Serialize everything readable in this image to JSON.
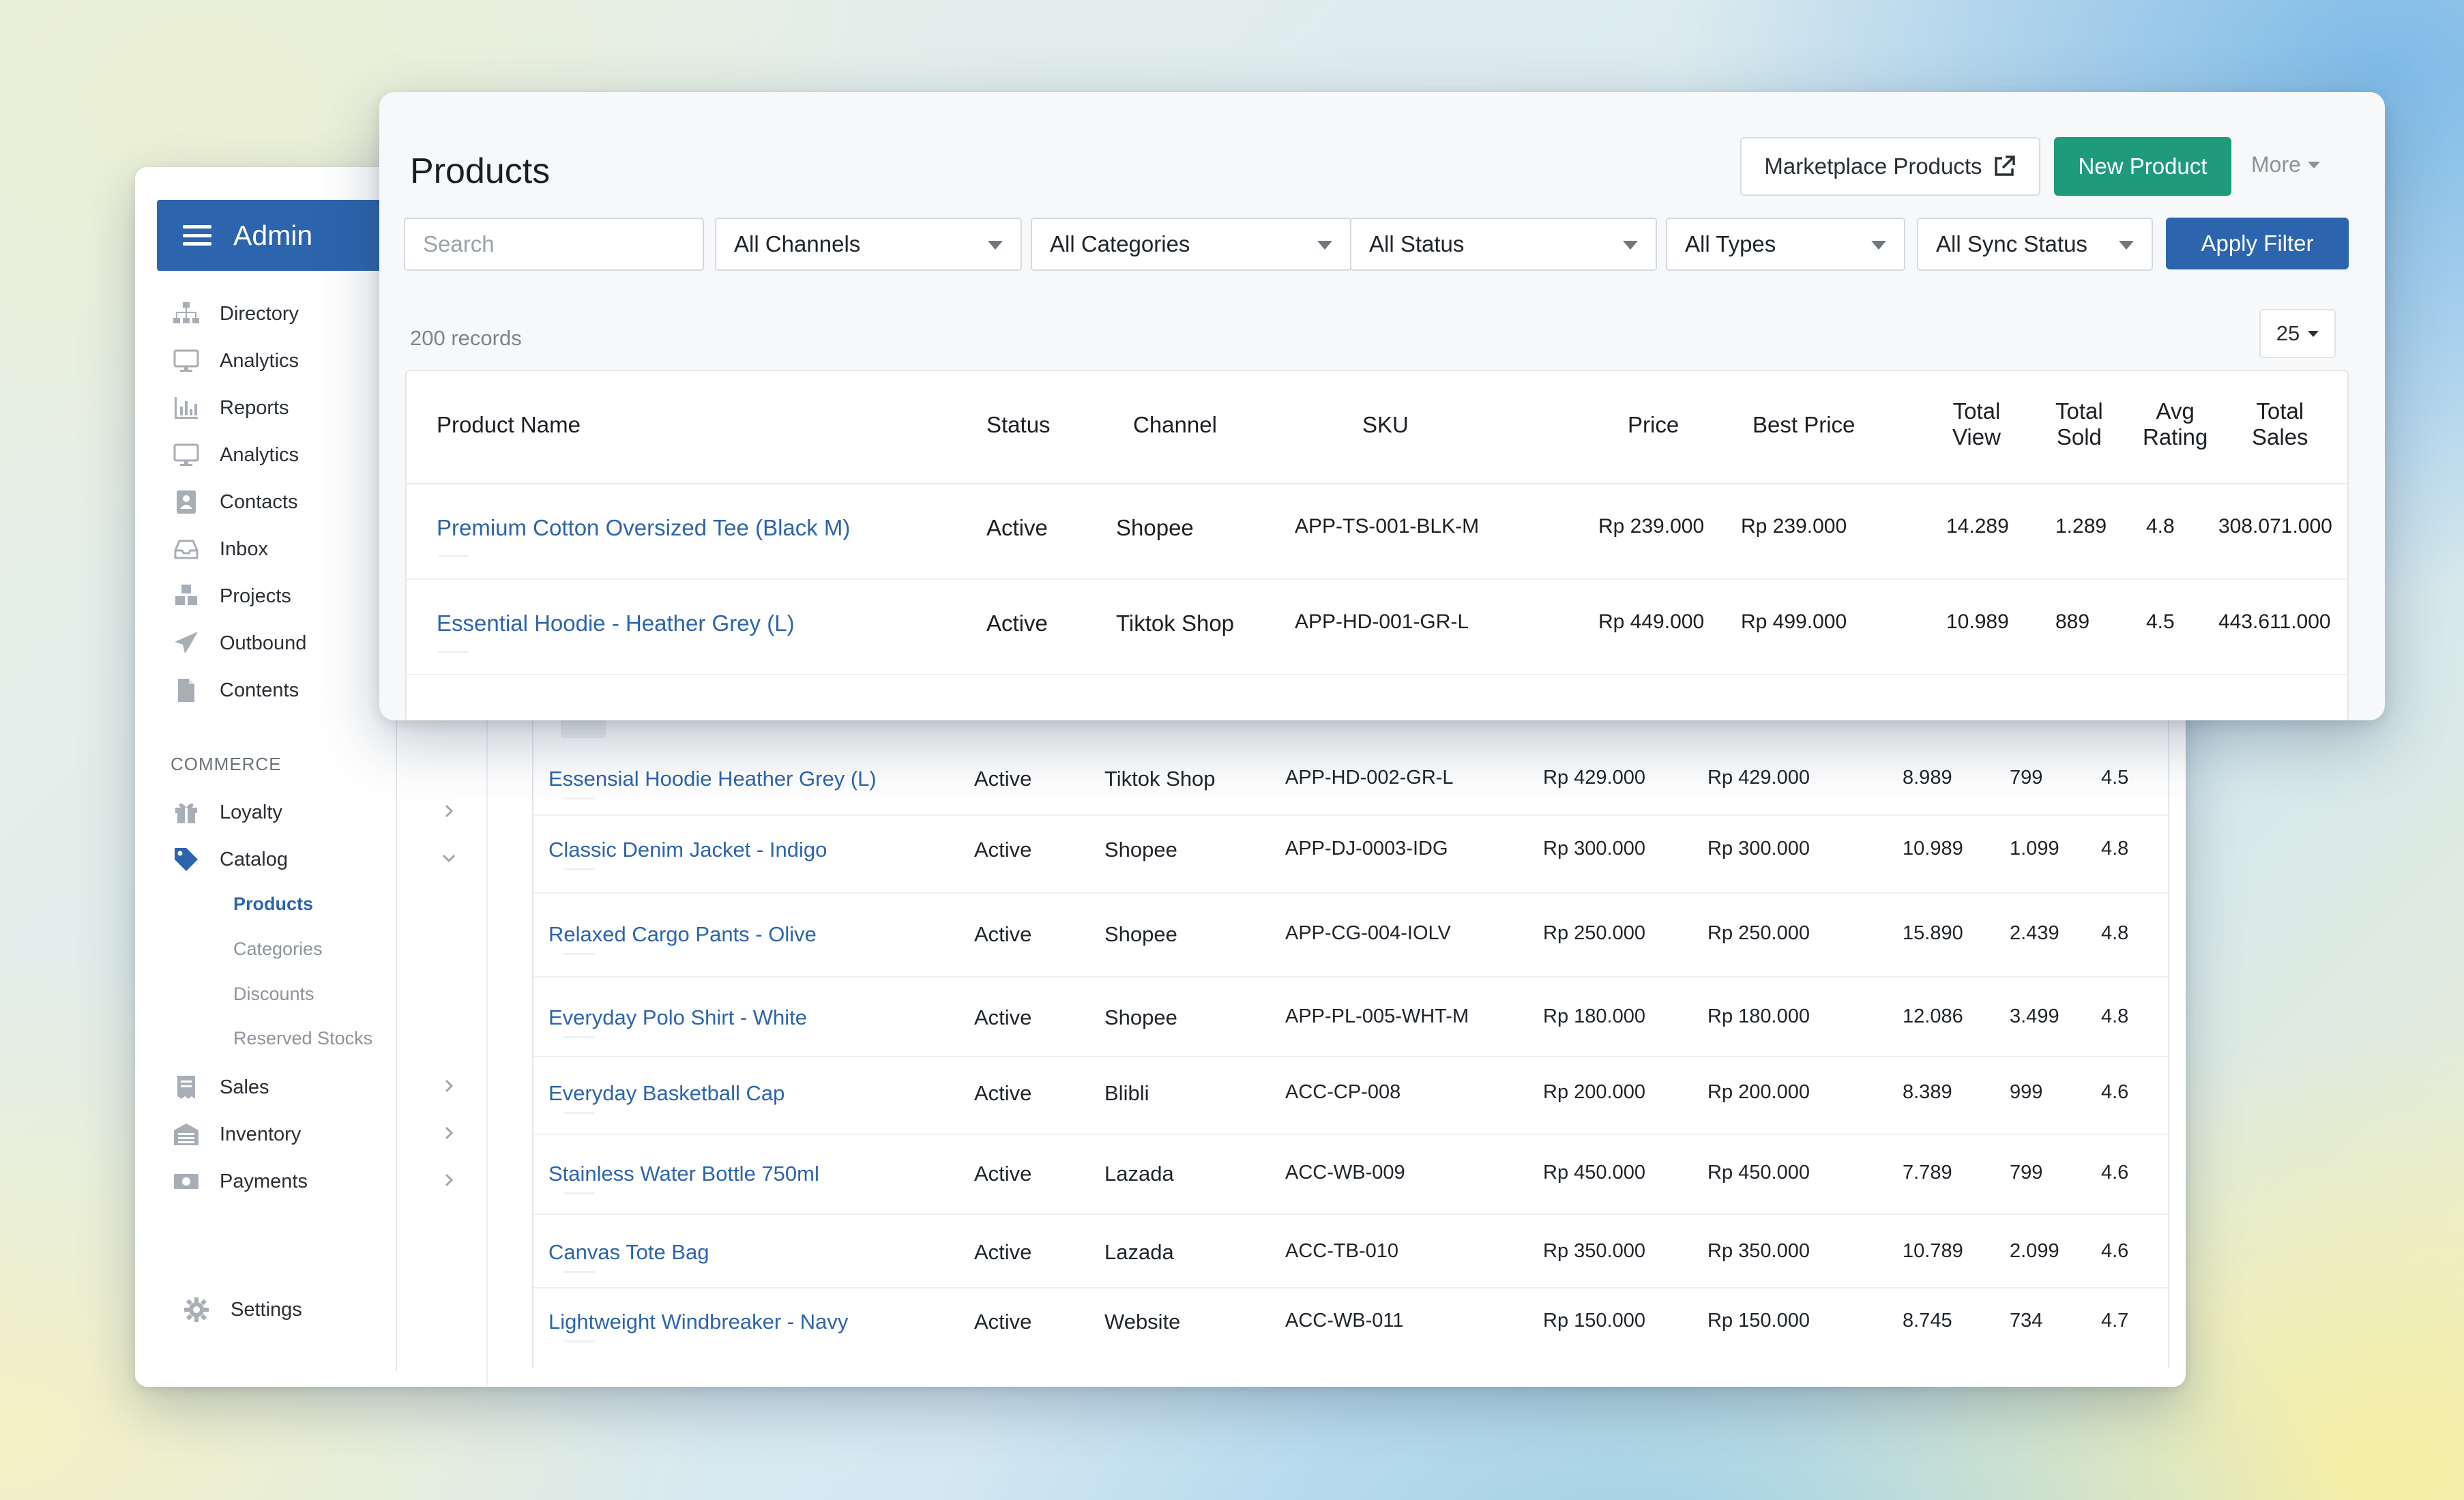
{
  "sidebar": {
    "brand": "Admin",
    "items": [
      {
        "label": "Directory",
        "icon": "sitemap-icon"
      },
      {
        "label": "Analytics",
        "icon": "monitor-icon"
      },
      {
        "label": "Reports",
        "icon": "bar-chart-icon"
      },
      {
        "label": "Analytics",
        "icon": "monitor-icon"
      },
      {
        "label": "Contacts",
        "icon": "contact-card-icon"
      },
      {
        "label": "Inbox",
        "icon": "inbox-icon"
      },
      {
        "label": "Projects",
        "icon": "cubes-icon"
      },
      {
        "label": "Outbound",
        "icon": "paper-plane-icon"
      },
      {
        "label": "Contents",
        "icon": "file-icon"
      }
    ],
    "section_label": "COMMERCE",
    "commerce_items": [
      {
        "label": "Loyalty",
        "icon": "gift-icon",
        "expanded": false
      },
      {
        "label": "Catalog",
        "icon": "tag-icon",
        "expanded": true
      }
    ],
    "catalog_sub": [
      {
        "label": "Products",
        "active": true
      },
      {
        "label": "Categories",
        "active": false
      },
      {
        "label": "Discounts",
        "active": false
      },
      {
        "label": "Reserved Stocks",
        "active": false
      }
    ],
    "more_items": [
      {
        "label": "Sales",
        "icon": "receipt-icon"
      },
      {
        "label": "Inventory",
        "icon": "warehouse-icon"
      },
      {
        "label": "Payments",
        "icon": "money-icon"
      }
    ],
    "settings_label": "Settings"
  },
  "header": {
    "title": "Products",
    "marketplace_button": "Marketplace Products",
    "new_button": "New Product",
    "more_label": "More"
  },
  "filters": {
    "search_placeholder": "Search",
    "channels": "All Channels",
    "categories": "All Categories",
    "status": "All Status",
    "types": "All Types",
    "sync_status": "All Sync Status",
    "apply": "Apply Filter"
  },
  "records_label": "200 records",
  "per_page": "25",
  "columns": {
    "name": "Product Name",
    "status": "Status",
    "channel": "Channel",
    "sku": "SKU",
    "price": "Price",
    "best_price": "Best Price",
    "total_view_1": "Total",
    "total_view_2": "View",
    "total_sold_1": "Total",
    "total_sold_2": "Sold",
    "avg_rating_1": "Avg",
    "avg_rating_2": "Rating",
    "total_sales_1": "Total",
    "total_sales_2": "Sales"
  },
  "front_rows": [
    {
      "name": "Premium Cotton Oversized Tee (Black M)",
      "status": "Active",
      "channel": "Shopee",
      "sku": "APP-TS-001-BLK-M",
      "price": "Rp 239.000",
      "best_price": "Rp 239.000",
      "views": "14.289",
      "sold": "1.289",
      "rating": "4.8",
      "sales": "308.071.000"
    },
    {
      "name": "Essential Hoodie - Heather Grey (L)",
      "status": "Active",
      "channel": "Tiktok Shop",
      "sku": "APP-HD-001-GR-L",
      "price": "Rp 449.000",
      "best_price": "Rp 499.000",
      "views": "10.989",
      "sold": "889",
      "rating": "4.5",
      "sales": "443.611.000"
    }
  ],
  "back_rows": [
    {
      "name": "Essensial Hoodie Heather Grey (L)",
      "status": "Active",
      "channel": "Tiktok Shop",
      "sku": "APP-HD-002-GR-L",
      "price": "Rp 429.000",
      "best_price": "Rp 429.000",
      "views": "8.989",
      "sold": "799",
      "rating": "4.5"
    },
    {
      "name": "Classic Denim Jacket - Indigo",
      "status": "Active",
      "channel": "Shopee",
      "sku": "APP-DJ-0003-IDG",
      "price": "Rp 300.000",
      "best_price": "Rp 300.000",
      "views": "10.989",
      "sold": "1.099",
      "rating": "4.8"
    },
    {
      "name": "Relaxed Cargo Pants - Olive",
      "status": "Active",
      "channel": "Shopee",
      "sku": "APP-CG-004-IOLV",
      "price": "Rp 250.000",
      "best_price": "Rp 250.000",
      "views": "15.890",
      "sold": "2.439",
      "rating": "4.8"
    },
    {
      "name": "Everyday Polo Shirt - White",
      "status": "Active",
      "channel": "Shopee",
      "sku": "APP-PL-005-WHT-M",
      "price": "Rp 180.000",
      "best_price": "Rp 180.000",
      "views": "12.086",
      "sold": "3.499",
      "rating": "4.8"
    },
    {
      "name": "Everyday Basketball Cap",
      "status": "Active",
      "channel": "Blibli",
      "sku": "ACC-CP-008",
      "price": "Rp 200.000",
      "best_price": "Rp 200.000",
      "views": "8.389",
      "sold": "999",
      "rating": "4.6"
    },
    {
      "name": "Stainless Water Bottle 750ml",
      "status": "Active",
      "channel": "Lazada",
      "sku": "ACC-WB-009",
      "price": "Rp 450.000",
      "best_price": "Rp 450.000",
      "views": "7.789",
      "sold": "799",
      "rating": "4.6"
    },
    {
      "name": "Canvas Tote Bag",
      "status": "Active",
      "channel": "Lazada",
      "sku": "ACC-TB-010",
      "price": "Rp 350.000",
      "best_price": "Rp 350.000",
      "views": "10.789",
      "sold": "2.099",
      "rating": "4.6"
    },
    {
      "name": "Lightweight Windbreaker - Navy",
      "status": "Active",
      "channel": "Website",
      "sku": "ACC-WB-011",
      "price": "Rp 150.000",
      "best_price": "Rp 150.000",
      "views": "8.745",
      "sold": "734",
      "rating": "4.7"
    }
  ],
  "colors": {
    "brand_blue": "#2c64ad",
    "new_button_green": "#1f9b7b",
    "link_blue": "#2c64ad"
  }
}
